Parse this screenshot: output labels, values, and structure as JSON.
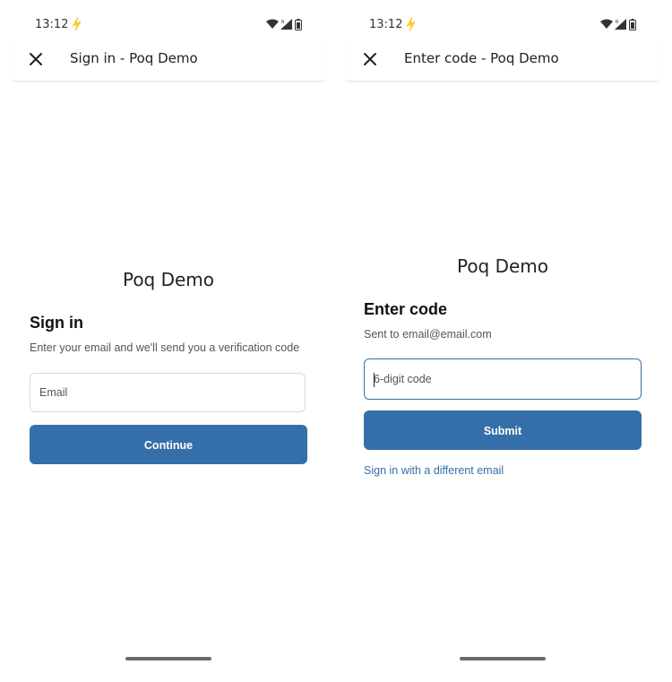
{
  "status_bar": {
    "time": "13:12",
    "extra_glyph": "⚡"
  },
  "sign_in_screen": {
    "toolbar_title": "Sign in - Poq Demo",
    "brand": "Poq Demo",
    "heading": "Sign in",
    "description": "Enter your email and we'll send you a verification code",
    "email_placeholder": "Email",
    "continue_label": "Continue"
  },
  "enter_code_screen": {
    "toolbar_title": "Enter code - Poq Demo",
    "brand": "Poq Demo",
    "heading": "Enter code",
    "sent_to": "Sent to email@email.com",
    "code_placeholder": "6-digit code",
    "submit_label": "Submit",
    "different_email_link": "Sign in with a different email"
  },
  "colors": {
    "primary": "#356fa9",
    "focus_border": "#3a6ea5",
    "link": "#356fa9"
  },
  "icons": [
    "close-icon",
    "wifi-icon",
    "signal-icon",
    "battery-icon"
  ]
}
